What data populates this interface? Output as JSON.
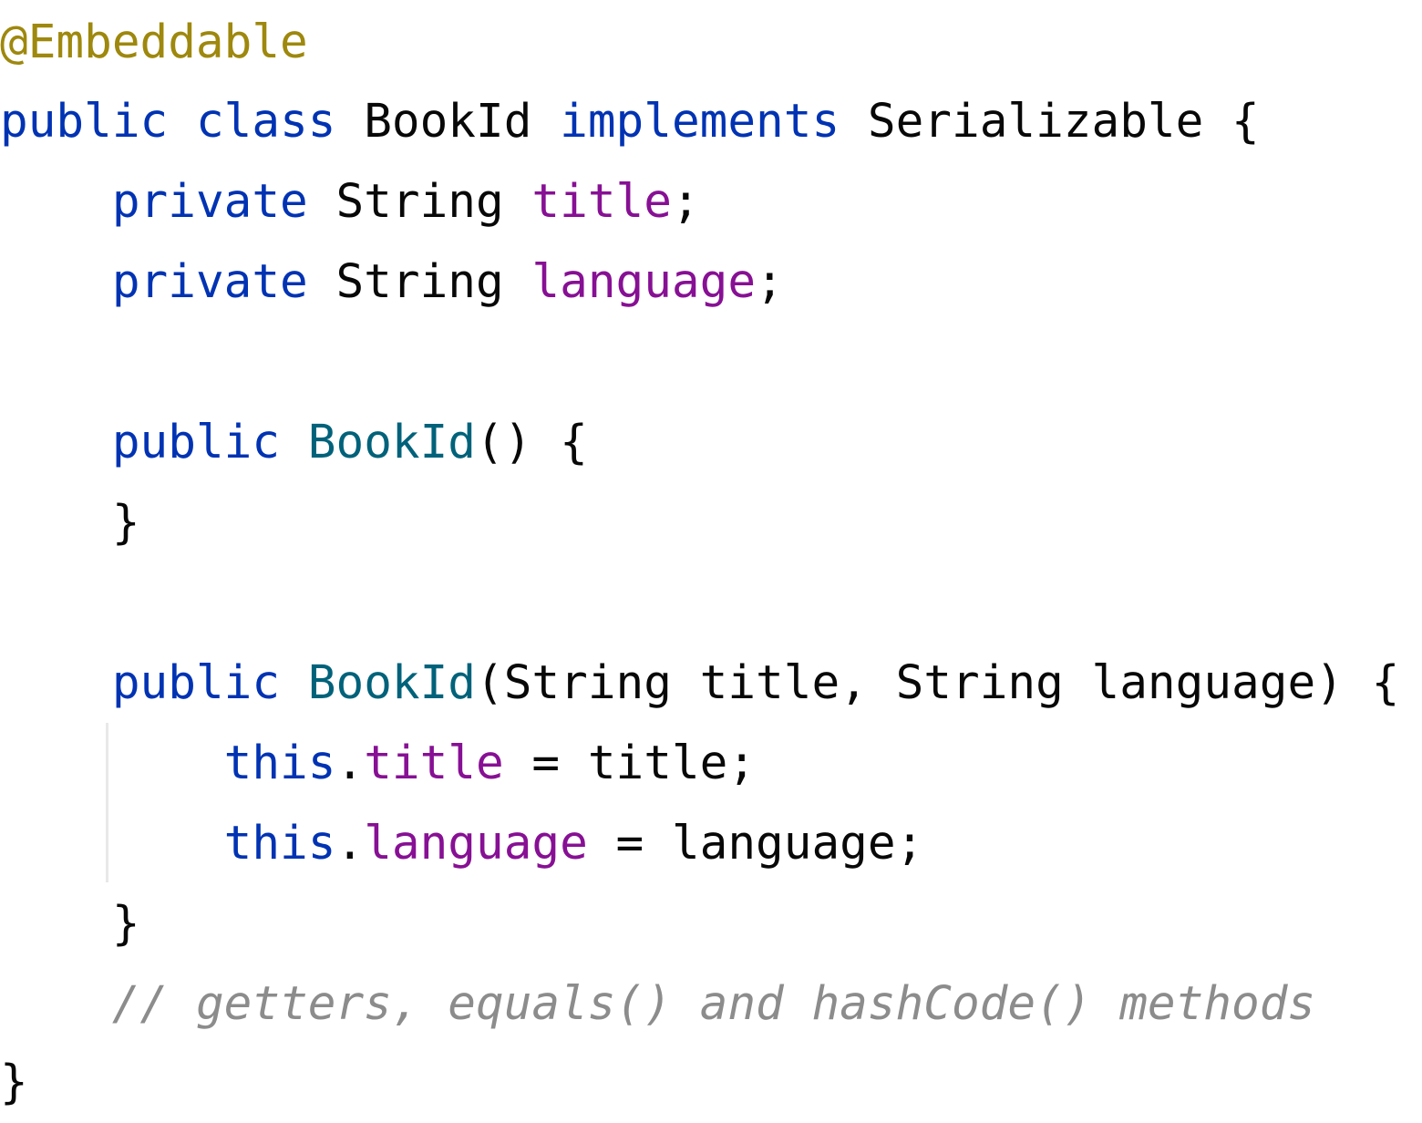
{
  "editor": {
    "theme_colors": {
      "annotation": "#9E880D",
      "keyword": "#0033B3",
      "field": "#871094",
      "method": "#00627A",
      "plain": "#080808",
      "comment": "#8C8C8C",
      "background": "#FFFFFF"
    },
    "lines": [
      {
        "tokens": [
          {
            "text": "@Embeddable",
            "kind": "annotation"
          }
        ]
      },
      {
        "tokens": [
          {
            "text": "public",
            "kind": "keyword"
          },
          {
            "text": " ",
            "kind": "plain"
          },
          {
            "text": "class",
            "kind": "keyword"
          },
          {
            "text": " BookId ",
            "kind": "plain"
          },
          {
            "text": "implements",
            "kind": "keyword"
          },
          {
            "text": " Serializable {",
            "kind": "plain"
          }
        ]
      },
      {
        "tokens": [
          {
            "text": "    ",
            "kind": "plain"
          },
          {
            "text": "private",
            "kind": "keyword"
          },
          {
            "text": " String ",
            "kind": "plain"
          },
          {
            "text": "title",
            "kind": "field"
          },
          {
            "text": ";",
            "kind": "plain"
          }
        ]
      },
      {
        "tokens": [
          {
            "text": "    ",
            "kind": "plain"
          },
          {
            "text": "private",
            "kind": "keyword"
          },
          {
            "text": " String ",
            "kind": "plain"
          },
          {
            "text": "language",
            "kind": "field"
          },
          {
            "text": ";",
            "kind": "plain"
          }
        ]
      },
      {
        "tokens": []
      },
      {
        "tokens": [
          {
            "text": "    ",
            "kind": "plain"
          },
          {
            "text": "public",
            "kind": "keyword"
          },
          {
            "text": " ",
            "kind": "plain"
          },
          {
            "text": "BookId",
            "kind": "method"
          },
          {
            "text": "() {",
            "kind": "plain"
          }
        ]
      },
      {
        "tokens": [
          {
            "text": "    }",
            "kind": "plain"
          }
        ]
      },
      {
        "tokens": []
      },
      {
        "tokens": [
          {
            "text": "    ",
            "kind": "plain"
          },
          {
            "text": "public",
            "kind": "keyword"
          },
          {
            "text": " ",
            "kind": "plain"
          },
          {
            "text": "BookId",
            "kind": "method"
          },
          {
            "text": "(String title, String language) {",
            "kind": "plain"
          }
        ]
      },
      {
        "tokens": [
          {
            "text": "        ",
            "kind": "plain"
          },
          {
            "text": "this",
            "kind": "keyword"
          },
          {
            "text": ".",
            "kind": "plain"
          },
          {
            "text": "title",
            "kind": "field"
          },
          {
            "text": " = title;",
            "kind": "plain"
          }
        ]
      },
      {
        "tokens": [
          {
            "text": "        ",
            "kind": "plain"
          },
          {
            "text": "this",
            "kind": "keyword"
          },
          {
            "text": ".",
            "kind": "plain"
          },
          {
            "text": "language",
            "kind": "field"
          },
          {
            "text": " = language;",
            "kind": "plain"
          }
        ]
      },
      {
        "tokens": [
          {
            "text": "    }",
            "kind": "plain"
          }
        ]
      },
      {
        "tokens": [
          {
            "text": "    ",
            "kind": "plain"
          },
          {
            "text": "// getters, equals() and hashCode() methods",
            "kind": "comment"
          }
        ]
      },
      {
        "tokens": [
          {
            "text": "}",
            "kind": "plain"
          }
        ]
      }
    ]
  }
}
